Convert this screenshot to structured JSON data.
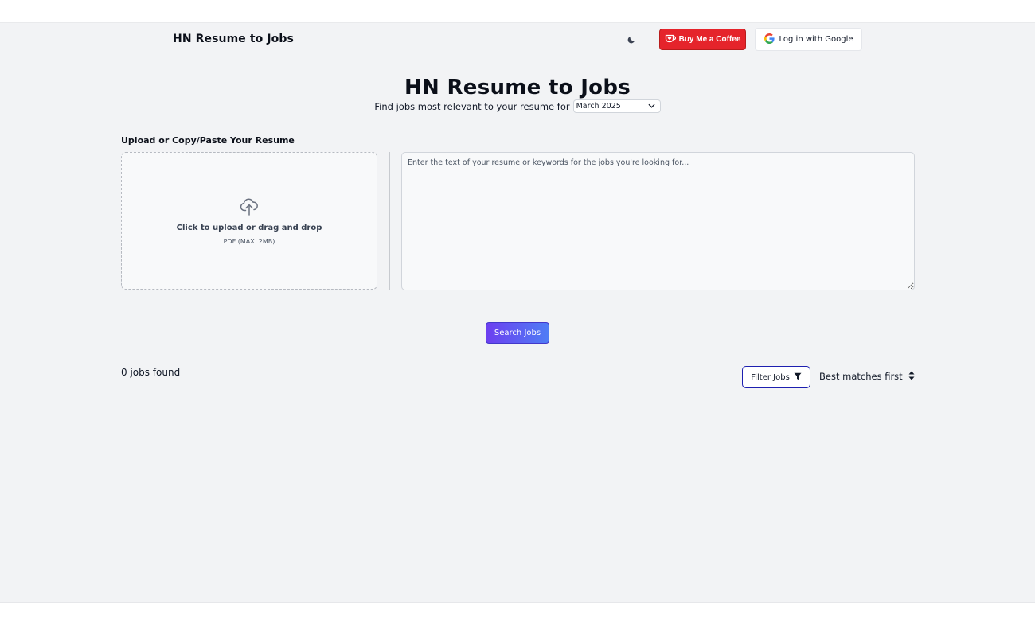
{
  "header": {
    "app_title": "HN Resume to Jobs",
    "theme_toggle_icon": "moon-icon",
    "coffee_button_label": "Buy Me a Coffee",
    "coffee_color": "#e5242b",
    "google_button_label": "Log in with Google"
  },
  "hero": {
    "title": "HN Resume to Jobs",
    "subtitle": "Find jobs most relevant to your resume for",
    "month_selected": "March 2025"
  },
  "upload": {
    "label": "Upload or Copy/Paste Your Resume",
    "dropzone_text": "Click to upload or drag and drop",
    "dropzone_hint": "PDF (MAX. 2MB)",
    "dropzone_icon": "cloud-upload-icon",
    "textarea_placeholder": "Enter the text of your resume or keywords for the jobs you're looking for...",
    "textarea_value": ""
  },
  "actions": {
    "search_label": "Search Jobs",
    "accent_from": "#6d3ff0",
    "accent_to": "#4f7df5"
  },
  "results": {
    "count_text": "0 jobs found",
    "filter_label": "Filter Jobs",
    "filter_icon": "funnel-icon",
    "sort_selected": "Best matches first",
    "sort_icon": "sort-arrows-icon"
  }
}
